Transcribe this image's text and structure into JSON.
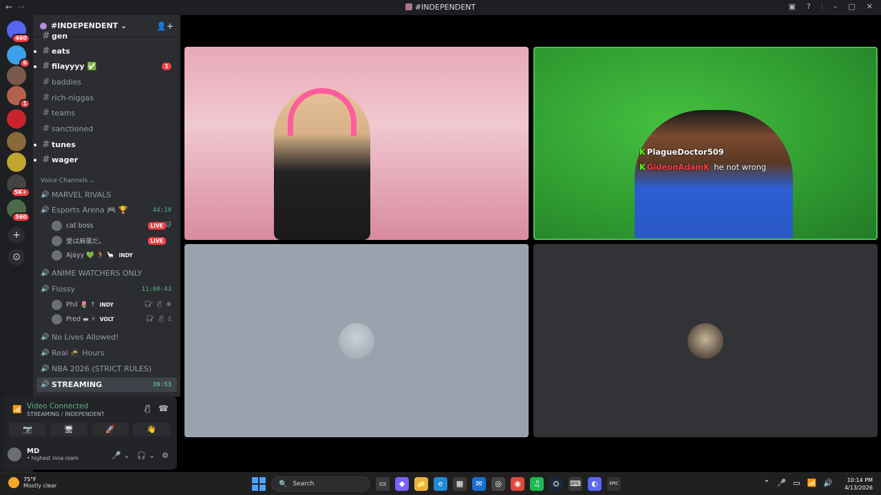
{
  "window": {
    "title": "#INDEPENDENT",
    "back": "←",
    "forward": "→",
    "icons": {
      "screen": "▣",
      "help": "?",
      "minimize": "–",
      "maximize": "□",
      "close": "✕"
    }
  },
  "servers": [
    {
      "badge": "460",
      "color": "#5865f2",
      "glyph": "◐"
    },
    {
      "badge": "6",
      "color": "#3aa0e8",
      "glyph": ""
    },
    {
      "badge": "",
      "color": "#7a5a4a",
      "glyph": ""
    },
    {
      "badge": "1",
      "color": "#b2624a",
      "glyph": ""
    },
    {
      "badge": "",
      "color": "#c9242b",
      "glyph": ""
    },
    {
      "badge": "",
      "color": "#8a6a3a",
      "glyph": ""
    },
    {
      "badge": "",
      "color": "#c2a531",
      "glyph": ""
    },
    {
      "badge": "5K+",
      "color": "#444",
      "glyph": ""
    },
    {
      "badge": "560",
      "color": "#4a6a4a",
      "glyph": ""
    }
  ],
  "server_actions": {
    "add": "+",
    "discover": "⊙"
  },
  "server_header": {
    "name": "#INDEPENDENT ⌄",
    "invite": "👤+"
  },
  "text_channels": [
    {
      "name": "gen",
      "bold": true,
      "dot": false,
      "mention": ""
    },
    {
      "name": "eats",
      "bold": true,
      "dot": true,
      "mention": ""
    },
    {
      "name": "filayyyy ✅",
      "bold": true,
      "dot": true,
      "mention": "1"
    },
    {
      "name": "baddies",
      "bold": false,
      "dot": false,
      "mention": ""
    },
    {
      "name": "rich-niggas",
      "bold": false,
      "dot": false,
      "mention": ""
    },
    {
      "name": "teams",
      "bold": false,
      "dot": false,
      "mention": ""
    },
    {
      "name": "sanctioned",
      "bold": false,
      "dot": false,
      "mention": ""
    },
    {
      "name": "tunes",
      "bold": true,
      "dot": true,
      "mention": ""
    },
    {
      "name": "wager",
      "bold": true,
      "dot": true,
      "mention": ""
    }
  ],
  "voice_section": "Voice Channels ⌄",
  "voice_channels": {
    "marvel": {
      "name": "MARVEL RIVALS"
    },
    "esports": {
      "name": "Esports Arena 🎮 🏆",
      "timer": "44:10"
    },
    "esports_users": [
      {
        "name": "cat boss",
        "tag": "",
        "live": "LIVE",
        "icons": "🐱"
      },
      {
        "name": "愛は麻薬だ。",
        "tag": "",
        "live": "LIVE",
        "icons": ""
      },
      {
        "name": "Ajayy 💚 🏃 🦙",
        "tag": "INDY",
        "live": "",
        "icons": ""
      }
    ],
    "anime": {
      "name": "ANIME WATCHERS ONLY"
    },
    "flossy": {
      "name": "Flossy",
      "timer": "11:00:43"
    },
    "flossy_users": [
      {
        "name": "Phil 🌷 ↑",
        "tag": "INDY",
        "icons": "🎧̸ 🎙̸ ⊗"
      },
      {
        "name": "Pred ▬ ⚡",
        "tag": "VOLT",
        "icons": "🎧̸ 🎙̸ ▯"
      }
    ],
    "nolives": {
      "name": "No Lives Allowed!"
    },
    "real": {
      "name": "Real 🥷 Hours"
    },
    "nba": {
      "name": "NBA 2026 (STRICT RULES)"
    },
    "streaming": {
      "name": "STREAMING",
      "timer": "39:53"
    }
  },
  "voice_panel": {
    "status": "Video Connected",
    "sub": "STREAMING / INDEPENDENT",
    "signal": "📶",
    "noise": "〰̸",
    "disconnect": "☎",
    "buttons": [
      "📷̸",
      "🖥",
      "🚀",
      "👋"
    ]
  },
  "user_panel": {
    "name": "MD",
    "status": "• highest inna room",
    "mic": "🎤 ⌄",
    "headset": "🎧 ⌄",
    "settings": "⚙"
  },
  "tiles": {
    "chat": [
      {
        "k": "K",
        "user": "PlagueDoctor509",
        "msg": ""
      },
      {
        "k": "K",
        "user": "GideonAdamK",
        "msg": "he not wrong"
      }
    ]
  },
  "taskbar": {
    "temp": "75°F",
    "condition": "Mostly clear",
    "search": "Search",
    "search_icon": "🔍",
    "apps": [
      "▭",
      "◆",
      "📁",
      "e",
      "▦",
      "✉",
      "◎",
      "◉",
      "♫",
      "⛭",
      "⌨",
      "◐",
      "EPIC"
    ],
    "tray": [
      "⌃",
      "🎤",
      "▭",
      "📶",
      "🔊"
    ],
    "time": "10:14 PM",
    "date": "4/13/2026"
  },
  "colors": {
    "accent": "#5865f2",
    "connected": "#57b585",
    "live": "#f23f43",
    "green_screen": "#35a83a"
  }
}
